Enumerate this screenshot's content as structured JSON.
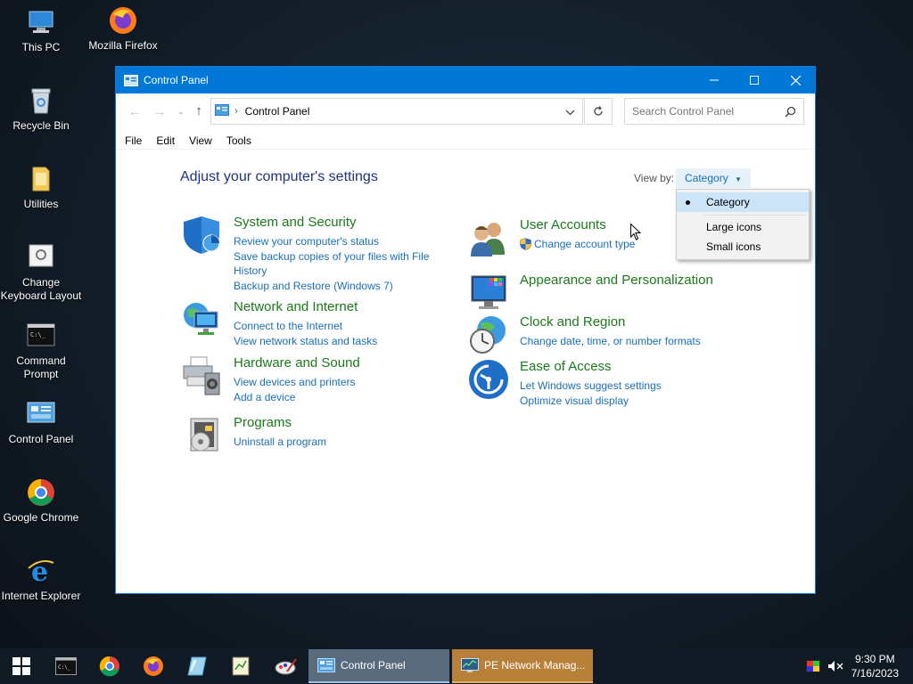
{
  "desktop": {
    "icons": [
      {
        "label": "This PC"
      },
      {
        "label": "Mozilla Firefox"
      },
      {
        "label": "Recycle Bin"
      },
      {
        "label": "Utilities"
      },
      {
        "label": "Change Keyboard Layout"
      },
      {
        "label": "Command Prompt"
      },
      {
        "label": "Control Panel"
      },
      {
        "label": "Google Chrome"
      },
      {
        "label": "Internet Explorer"
      }
    ]
  },
  "window": {
    "title": "Control Panel",
    "address": "Control Panel",
    "search_placeholder": "Search Control Panel",
    "menu": [
      "File",
      "Edit",
      "View",
      "Tools"
    ],
    "heading": "Adjust your computer's settings",
    "view_by_label": "View by:",
    "view_by_value": "Category",
    "categories": [
      {
        "title": "System and Security",
        "links": [
          "Review your computer's status",
          "Save backup copies of your files with File History",
          "Backup and Restore (Windows 7)"
        ]
      },
      {
        "title": "Network and Internet",
        "links": [
          "Connect to the Internet",
          "View network status and tasks"
        ]
      },
      {
        "title": "Hardware and Sound",
        "links": [
          "View devices and printers",
          "Add a device"
        ]
      },
      {
        "title": "Programs",
        "links": [
          "Uninstall a program"
        ]
      },
      {
        "title": "User Accounts",
        "links": [
          "Change account type"
        ]
      },
      {
        "title": "Appearance and Personalization",
        "links": []
      },
      {
        "title": "Clock and Region",
        "links": [
          "Change date, time, or number formats"
        ]
      },
      {
        "title": "Ease of Access",
        "links": [
          "Let Windows suggest settings",
          "Optimize visual display"
        ]
      }
    ],
    "dropdown": [
      "Category",
      "Large icons",
      "Small icons"
    ]
  },
  "taskbar": {
    "tasks": [
      "Control Panel",
      "PE Network Manag..."
    ],
    "time": "9:30 PM",
    "date": "7/16/2023"
  },
  "colors": {
    "accent": "#0078d7",
    "category_title": "#1a7a1a",
    "link": "#1a6fb5",
    "heading": "#1e3287"
  }
}
